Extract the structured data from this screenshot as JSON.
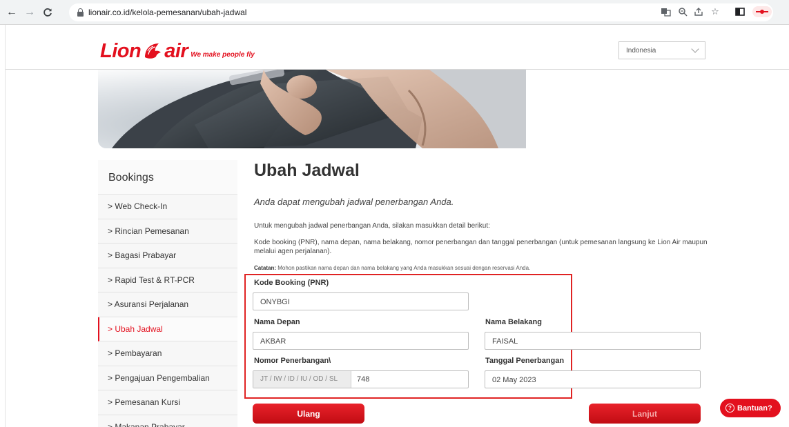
{
  "browser": {
    "url": "lionair.co.id/kelola-pemesanan/ubah-jadwal"
  },
  "header": {
    "logo_word_left": "Lion",
    "logo_word_right": "air",
    "tagline": "We make people fly",
    "language": "Indonesia"
  },
  "sidebar": {
    "title": "Bookings",
    "items": [
      {
        "label": "> Web Check-In"
      },
      {
        "label": "> Rincian Pemesanan"
      },
      {
        "label": "> Bagasi Prabayar"
      },
      {
        "label": "> Rapid Test & RT-PCR"
      },
      {
        "label": "> Asuransi Perjalanan"
      },
      {
        "label": "> Ubah Jadwal"
      },
      {
        "label": "> Pembayaran"
      },
      {
        "label": "> Pengajuan Pengembalian"
      },
      {
        "label": "> Pemesanan Kursi"
      },
      {
        "label": "> Makanan Prabayar"
      }
    ]
  },
  "main": {
    "title": "Ubah Jadwal",
    "subtitle": "Anda dapat mengubah jadwal penerbangan Anda.",
    "intro": "Untuk mengubah jadwal penerbangan Anda, silakan masukkan detail berikut:",
    "intro2": "Kode booking (PNR), nama depan, nama belakang, nomor penerbangan dan tanggal penerbangan (untuk pemesanan langsung ke Lion Air maupun melalui agen perjalanan).",
    "note_label": "Catatan:",
    "note_text": " Mohon pastikan nama depan dan nama belakang yang Anda masukkan sesuai dengan reservasi Anda."
  },
  "form": {
    "pnr_label": "Kode Booking (PNR)",
    "pnr_value": "ONYBGI",
    "first_name_label": "Nama Depan",
    "first_name_value": "AKBAR",
    "last_name_label": "Nama Belakang",
    "last_name_value": "FAISAL",
    "flight_no_label": "Nomor Penerbangan\\",
    "flight_no_prefix": "JT / IW / ID / IU / OD / SL",
    "flight_no_value": "748",
    "flight_date_label": "Tanggal Penerbangan",
    "flight_date_value": "02 May 2023"
  },
  "buttons": {
    "reset": "Ulang",
    "next": "Lanjut",
    "help": "Bantuan?"
  },
  "colors": {
    "brand_red": "#e3101e",
    "highlight_frame": "#e02323"
  }
}
